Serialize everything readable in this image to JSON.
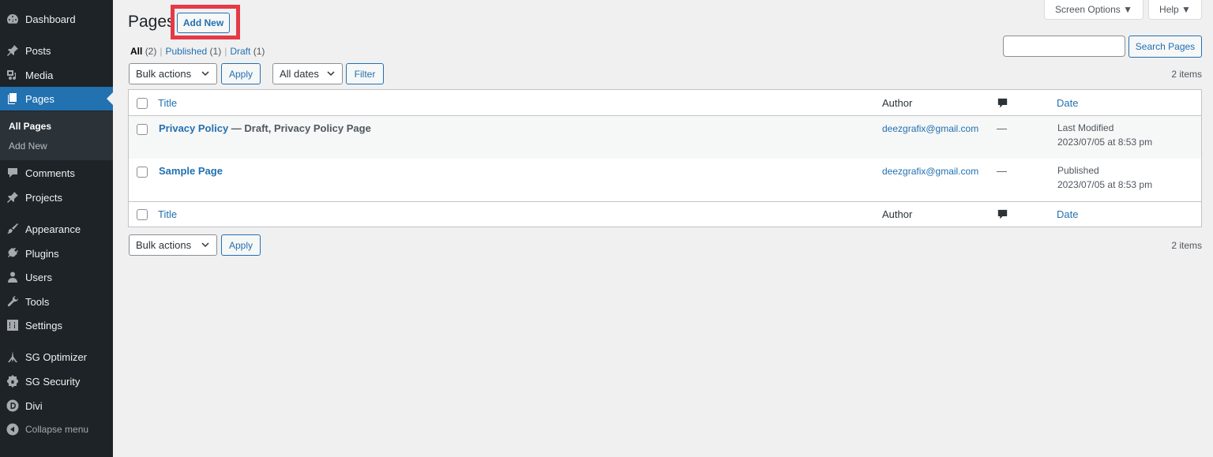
{
  "sidebar": {
    "items": [
      {
        "label": "Dashboard",
        "icon": "dashboard-icon"
      },
      {
        "label": "Posts",
        "icon": "pin-icon"
      },
      {
        "label": "Media",
        "icon": "media-icon"
      },
      {
        "label": "Pages",
        "icon": "pages-icon",
        "active": true
      },
      {
        "label": "Comments",
        "icon": "comment-icon"
      },
      {
        "label": "Projects",
        "icon": "pin-icon"
      },
      {
        "label": "Appearance",
        "icon": "brush-icon"
      },
      {
        "label": "Plugins",
        "icon": "plug-icon"
      },
      {
        "label": "Users",
        "icon": "user-icon"
      },
      {
        "label": "Tools",
        "icon": "wrench-icon"
      },
      {
        "label": "Settings",
        "icon": "settings-icon"
      },
      {
        "label": "SG Optimizer",
        "icon": "sg-optimizer-icon"
      },
      {
        "label": "SG Security",
        "icon": "sg-security-icon"
      },
      {
        "label": "Divi",
        "icon": "divi-icon"
      },
      {
        "label": "Collapse menu",
        "icon": "collapse-icon"
      }
    ],
    "submenu": [
      {
        "label": "All Pages",
        "current": true
      },
      {
        "label": "Add New"
      }
    ]
  },
  "header": {
    "title": "Pages",
    "add_new": "Add New",
    "screen_options": "Screen Options ▼",
    "help": "Help ▼"
  },
  "filters": {
    "all": "All",
    "all_count": "(2)",
    "published": "Published",
    "published_count": "(1)",
    "draft": "Draft",
    "draft_count": "(1)",
    "separator": "|"
  },
  "search": {
    "value": "",
    "button": "Search Pages"
  },
  "top_nav": {
    "bulk_actions": "Bulk actions",
    "apply": "Apply",
    "dates": "All dates",
    "filter": "Filter",
    "items_count": "2 items"
  },
  "bottom_nav": {
    "bulk_actions": "Bulk actions",
    "apply": "Apply",
    "items_count": "2 items"
  },
  "table": {
    "columns": {
      "title": "Title",
      "author": "Author",
      "comments": "comment-icon",
      "date": "Date"
    },
    "rows": [
      {
        "title": "Privacy Policy",
        "state": " — Draft, Privacy Policy Page",
        "author": "deezgrafix@gmail.com",
        "comments": "—",
        "date_status": "Last Modified",
        "date": "2023/07/05 at 8:53 pm"
      },
      {
        "title": "Sample Page",
        "state": "",
        "author": "deezgrafix@gmail.com",
        "comments": "—",
        "date_status": "Published",
        "date": "2023/07/05 at 8:53 pm"
      }
    ]
  },
  "colors": {
    "sidebar_bg": "#1d2327",
    "accent": "#2271b1",
    "highlight_box": "#e63946"
  }
}
